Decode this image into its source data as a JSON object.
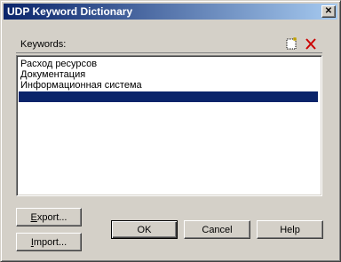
{
  "window": {
    "title": "UDP Keyword Dictionary",
    "close_glyph": "✕"
  },
  "keywords": {
    "label": "Keywords:",
    "items": [
      "Расход ресурсов",
      "Документация",
      "Информационная система",
      ""
    ],
    "selected_index": 3
  },
  "buttons": {
    "export_first": "E",
    "export_rest": "xport...",
    "import_first": "I",
    "import_rest": "mport...",
    "ok": "OK",
    "cancel": "Cancel",
    "help": "Help"
  },
  "colors": {
    "selection": "#0a246a",
    "delete_icon": "#cc0000"
  }
}
